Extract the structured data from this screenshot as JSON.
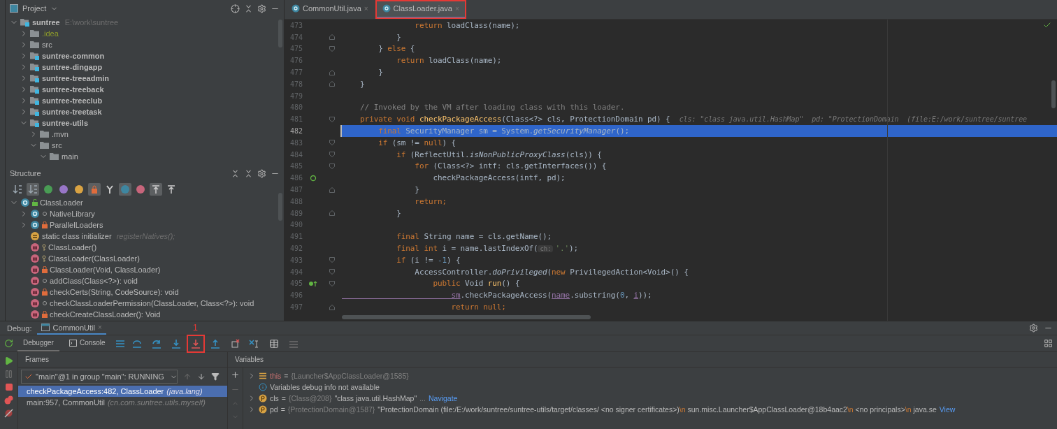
{
  "project_panel": {
    "title": "Project",
    "tree": [
      {
        "name": "suntree",
        "hint": "E:\\work\\suntree",
        "kind": "module",
        "expanded": true,
        "children": [
          {
            "name": ".idea",
            "kind": "idea",
            "expanded": false
          },
          {
            "name": "src",
            "kind": "folder",
            "expanded": false
          },
          {
            "name": "suntree-common",
            "kind": "module",
            "expanded": false
          },
          {
            "name": "suntree-dingapp",
            "kind": "module",
            "expanded": false
          },
          {
            "name": "suntree-treeadmin",
            "kind": "module",
            "expanded": false
          },
          {
            "name": "suntree-treeback",
            "kind": "module",
            "expanded": false
          },
          {
            "name": "suntree-treeclub",
            "kind": "module",
            "expanded": false
          },
          {
            "name": "suntree-treetask",
            "kind": "module",
            "expanded": false
          },
          {
            "name": "suntree-utils",
            "kind": "module",
            "expanded": true,
            "children": [
              {
                "name": ".mvn",
                "kind": "folder",
                "expanded": false
              },
              {
                "name": "src",
                "kind": "folder",
                "expanded": true,
                "children": [
                  {
                    "name": "main",
                    "kind": "folder",
                    "expanded": true
                  }
                ]
              }
            ]
          }
        ]
      }
    ]
  },
  "structure_panel": {
    "title": "Structure",
    "toolbar": [
      {
        "kind": "sort-visibility",
        "on": false
      },
      {
        "kind": "sort-alpha",
        "on": true
      },
      {
        "kind": "inherited",
        "on": false
      },
      {
        "kind": "properties",
        "on": false
      },
      {
        "kind": "fields",
        "on": false
      },
      {
        "kind": "non-public",
        "on": true
      },
      {
        "kind": "merge",
        "on": false
      },
      {
        "kind": "anonymous",
        "on": true
      },
      {
        "kind": "lambda",
        "on": false
      },
      {
        "kind": "autoscroll-to",
        "on": true
      },
      {
        "kind": "autoscroll-from",
        "on": false
      }
    ],
    "tree": [
      {
        "label": "ClassLoader",
        "kind": "class-public",
        "expanded": true,
        "children": [
          {
            "label": "NativeLibrary",
            "kind": "class-package",
            "expanded": false
          },
          {
            "label": "ParallelLoaders",
            "kind": "class-private",
            "expanded": false
          },
          {
            "label": "static class initializer",
            "hint": "registerNatives();",
            "kind": "initializer"
          },
          {
            "label": "ClassLoader()",
            "kind": "method-protected"
          },
          {
            "label": "ClassLoader(ClassLoader)",
            "kind": "method-protected"
          },
          {
            "label": "ClassLoader(Void, ClassLoader)",
            "kind": "method-private"
          },
          {
            "label": "addClass(Class<?>): void",
            "kind": "method-package"
          },
          {
            "label": "checkCerts(String, CodeSource): void",
            "kind": "method-private"
          },
          {
            "label": "checkClassLoaderPermission(ClassLoader, Class<?>): void",
            "kind": "method-package"
          },
          {
            "label": "checkCreateClassLoader(): Void",
            "kind": "method-private"
          }
        ]
      }
    ]
  },
  "editor": {
    "tabs": [
      {
        "label": "CommonUtil.java",
        "close": "×",
        "selected": false,
        "annotated": false
      },
      {
        "label": "ClassLoader.java",
        "close": "×",
        "selected": true,
        "annotated": true
      }
    ],
    "lines": [
      {
        "number": "473",
        "current": false,
        "kind": "plain",
        "segments": [
          {
            "kind": "kw",
            "text": "                return "
          },
          {
            "kind": "plain",
            "text": "loadClass(name);"
          }
        ]
      },
      {
        "number": "474",
        "current": false,
        "kind": "fold-end",
        "segments": [
          {
            "kind": "plain",
            "text": "            }"
          }
        ]
      },
      {
        "number": "475",
        "current": false,
        "kind": "fold-start",
        "segments": [
          {
            "kind": "plain",
            "text": "        } "
          },
          {
            "kind": "kw",
            "text": "else "
          },
          {
            "kind": "plain",
            "text": "{"
          }
        ]
      },
      {
        "number": "476",
        "current": false,
        "kind": "plain",
        "segments": [
          {
            "kind": "kw",
            "text": "            return "
          },
          {
            "kind": "plain",
            "text": "loadClass(name);"
          }
        ]
      },
      {
        "number": "477",
        "current": false,
        "kind": "fold-end",
        "segments": [
          {
            "kind": "plain",
            "text": "        }"
          }
        ]
      },
      {
        "number": "478",
        "current": false,
        "kind": "fold-end",
        "segments": [
          {
            "kind": "plain",
            "text": "    }"
          }
        ]
      },
      {
        "number": "479",
        "current": false,
        "kind": "plain"
      },
      {
        "number": "480",
        "current": false,
        "kind": "plain",
        "segments": [
          {
            "kind": "comment",
            "text": "    // Invoked by the VM after loading class with this loader."
          }
        ]
      },
      {
        "number": "481",
        "current": false,
        "kind": "fold-start",
        "segments": [
          {
            "kind": "kw",
            "text": "    private void "
          },
          {
            "kind": "fn",
            "text": "checkPackageAccess"
          },
          {
            "kind": "plain",
            "text": "(Class<?> cls, ProtectionDomain pd) {  "
          },
          {
            "kind": "hint",
            "text": "cls: \"class java.util.HashMap\"  pd: \"ProtectionDomain  (file:E:/work/suntree/suntree"
          }
        ]
      },
      {
        "number": "482",
        "current": true,
        "kind": "plain",
        "segments": [
          {
            "kind": "kw",
            "text": "        final "
          },
          {
            "kind": "plain",
            "text": "SecurityManager sm = System."
          },
          {
            "kind": "italic",
            "text": "getSecurityManager"
          },
          {
            "kind": "plain",
            "text": "();"
          }
        ]
      },
      {
        "number": "483",
        "current": false,
        "kind": "fold-start",
        "segments": [
          {
            "kind": "kw",
            "text": "        if "
          },
          {
            "kind": "plain",
            "text": "(sm != "
          },
          {
            "kind": "kw",
            "text": "null"
          },
          {
            "kind": "plain",
            "text": ") {"
          }
        ]
      },
      {
        "number": "484",
        "current": false,
        "kind": "fold-start",
        "segments": [
          {
            "kind": "kw",
            "text": "            if "
          },
          {
            "kind": "plain",
            "text": "(ReflectUtil."
          },
          {
            "kind": "italic",
            "text": "isNonPublicProxyClass"
          },
          {
            "kind": "plain",
            "text": "(cls)) {"
          }
        ]
      },
      {
        "number": "485",
        "current": false,
        "kind": "fold-start",
        "segments": [
          {
            "kind": "kw",
            "text": "                for "
          },
          {
            "kind": "plain",
            "text": "(Class<?> intf: cls.getInterfaces()) {"
          }
        ]
      },
      {
        "number": "486",
        "current": false,
        "kind": "recursion",
        "segments": [
          {
            "kind": "plain",
            "text": "                    checkPackageAccess(intf, pd);"
          }
        ]
      },
      {
        "number": "487",
        "current": false,
        "kind": "fold-end",
        "segments": [
          {
            "kind": "plain",
            "text": "                }"
          }
        ]
      },
      {
        "number": "488",
        "current": false,
        "kind": "plain",
        "segments": [
          {
            "kind": "kw",
            "text": "                return;"
          }
        ]
      },
      {
        "number": "489",
        "current": false,
        "kind": "fold-end",
        "segments": [
          {
            "kind": "plain",
            "text": "            }"
          }
        ]
      },
      {
        "number": "490",
        "current": false,
        "kind": "plain"
      },
      {
        "number": "491",
        "current": false,
        "kind": "plain",
        "segments": [
          {
            "kind": "kw",
            "text": "            final "
          },
          {
            "kind": "plain",
            "text": "String name = cls.getName();"
          }
        ]
      },
      {
        "number": "492",
        "current": false,
        "kind": "plain",
        "segments": [
          {
            "kind": "kw",
            "text": "            final int "
          },
          {
            "kind": "plain",
            "text": "i = name.lastIndexOf("
          },
          {
            "kind": "inlay",
            "text": "ch:"
          },
          {
            "kind": "str",
            "text": "'.'"
          },
          {
            "kind": "plain",
            "text": ");"
          }
        ]
      },
      {
        "number": "493",
        "current": false,
        "kind": "fold-start",
        "segments": [
          {
            "kind": "kw",
            "text": "            if "
          },
          {
            "kind": "plain",
            "text": "(i != "
          },
          {
            "kind": "num",
            "text": "-1"
          },
          {
            "kind": "plain",
            "text": ") {"
          }
        ]
      },
      {
        "number": "494",
        "current": false,
        "kind": "fold-start",
        "segments": [
          {
            "kind": "plain",
            "text": "                AccessController."
          },
          {
            "kind": "italic",
            "text": "doPrivileged"
          },
          {
            "kind": "plain",
            "text": "("
          },
          {
            "kind": "kw",
            "text": "new "
          },
          {
            "kind": "plain",
            "text": "PrivilegedAction<Void>() {"
          }
        ]
      },
      {
        "number": "495",
        "current": false,
        "kind": "override",
        "segments": [
          {
            "kind": "kw",
            "text": "                    public "
          },
          {
            "kind": "plain",
            "text": "Void "
          },
          {
            "kind": "fn",
            "text": "run"
          },
          {
            "kind": "plain",
            "text": "() {"
          }
        ]
      },
      {
        "number": "496",
        "current": false,
        "kind": "plain",
        "segments": [
          {
            "kind": "field",
            "text": "                        sm"
          },
          {
            "kind": "plain",
            "text": ".checkPackageAccess("
          },
          {
            "kind": "field",
            "text": "name"
          },
          {
            "kind": "plain",
            "text": ".substring("
          },
          {
            "kind": "num",
            "text": "0"
          },
          {
            "kind": "plain",
            "text": ", "
          },
          {
            "kind": "field",
            "text": "i"
          },
          {
            "kind": "plain",
            "text": "));"
          }
        ]
      },
      {
        "number": "497",
        "current": false,
        "kind": "fold-end",
        "segments": [
          {
            "kind": "kw",
            "text": "                        return null;"
          }
        ]
      }
    ]
  },
  "debug": {
    "title": "Debug:",
    "session": {
      "label": "CommonUtil",
      "close": "×"
    },
    "tabs": [
      {
        "label": "Debugger",
        "selected": true
      },
      {
        "label": "Console",
        "selected": false
      }
    ],
    "toolbar": [
      {
        "kind": "show-execution-point",
        "annotated": false
      },
      {
        "kind": "step-over",
        "annotated": false
      },
      {
        "kind": "step-into",
        "annotated": false
      },
      {
        "kind": "force-step-into",
        "annotated": true,
        "annotation_label": "1"
      },
      {
        "kind": "step-out",
        "annotated": false
      },
      {
        "kind": "drop-frame",
        "annotated": false
      },
      {
        "kind": "run-to-cursor",
        "annotated": false
      },
      {
        "kind": "evaluate",
        "annotated": false
      },
      {
        "kind": "trace",
        "annotated": false
      }
    ],
    "frames": {
      "title": "Frames",
      "thread": "\"main\"@1 in group \"main\": RUNNING",
      "items": [
        {
          "text": "checkPackageAccess:482, ClassLoader",
          "package": "(java.lang)",
          "selected": true
        },
        {
          "text": "main:957, CommonUtil",
          "package": "(cn.com.suntree.utils.myself)",
          "selected": false
        }
      ]
    },
    "variables": {
      "title": "Variables",
      "rows": [
        {
          "kind": "object",
          "name": "this",
          "operator": "=",
          "type": "{Launcher$AppClassLoader@1585}"
        },
        {
          "kind": "info",
          "text": "Variables debug info not available"
        },
        {
          "kind": "param",
          "name": "cls",
          "operator": "=",
          "type": "{Class@208}",
          "value": [
            {
              "kind": "text",
              "text": "\"class java.util.HashMap\""
            }
          ],
          "ellipsis": "...",
          "link": "Navigate"
        },
        {
          "kind": "param",
          "name": "pd",
          "operator": "=",
          "type": "{ProtectionDomain@1587}",
          "value": [
            {
              "kind": "text",
              "text": "\"ProtectionDomain  (file:/E:/work/suntree/suntree-utils/target/classes/ <no signer certificates>)"
            },
            {
              "kind": "escape",
              "text": "\\n"
            },
            {
              "kind": "text",
              "text": " sun.misc.Launcher$AppClassLoader@18b4aac2"
            },
            {
              "kind": "escape",
              "text": "\\n"
            },
            {
              "kind": "text",
              "text": " <no principals>"
            },
            {
              "kind": "escape",
              "text": "\\n"
            },
            {
              "kind": "text",
              "text": " java.se"
            }
          ],
          "link": "View"
        }
      ]
    }
  }
}
